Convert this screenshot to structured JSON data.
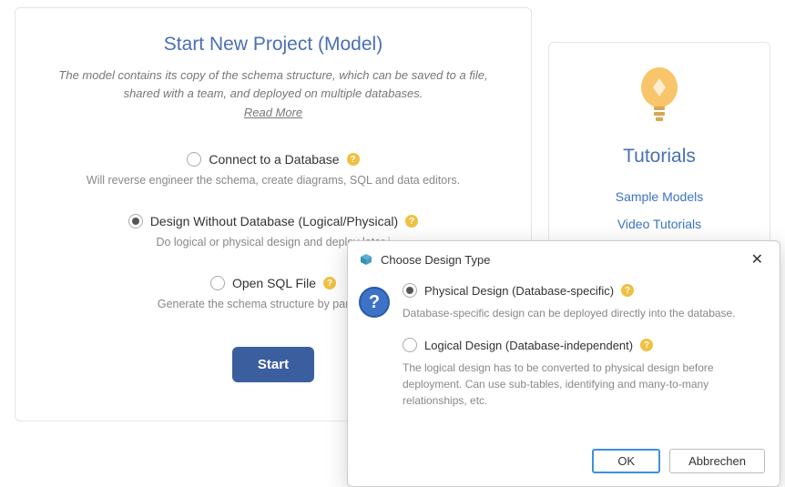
{
  "main": {
    "title": "Start New Project (Model)",
    "description": "The model contains its copy of the schema structure, which can be saved to a file, shared with a team, and deployed on multiple databases.",
    "read_more": "Read More",
    "options": [
      {
        "label": "Connect to a Database",
        "desc": "Will reverse engineer the schema, create diagrams, SQL and data editors.",
        "selected": false
      },
      {
        "label": "Design Without Database (Logical/Physical)",
        "desc": "Do logical or physical design and deploy later i",
        "selected": true
      },
      {
        "label": "Open SQL File",
        "desc": "Generate the schema structure by parsing the",
        "selected": false
      }
    ],
    "start_label": "Start"
  },
  "side": {
    "title": "Tutorials",
    "links": [
      "Sample Models",
      "Video Tutorials"
    ]
  },
  "dialog": {
    "title": "Choose Design Type",
    "options": [
      {
        "label": "Physical Design (Database-specific)",
        "desc": "Database-specific design can be deployed directly into the database.",
        "selected": true
      },
      {
        "label": "Logical Design (Database-independent)",
        "desc": "The logical design has to be converted to physical design before deployment. Can use sub-tables, identifying and many-to-many relationships, etc.",
        "selected": false
      }
    ],
    "ok_label": "OK",
    "cancel_label": "Abbrechen"
  }
}
